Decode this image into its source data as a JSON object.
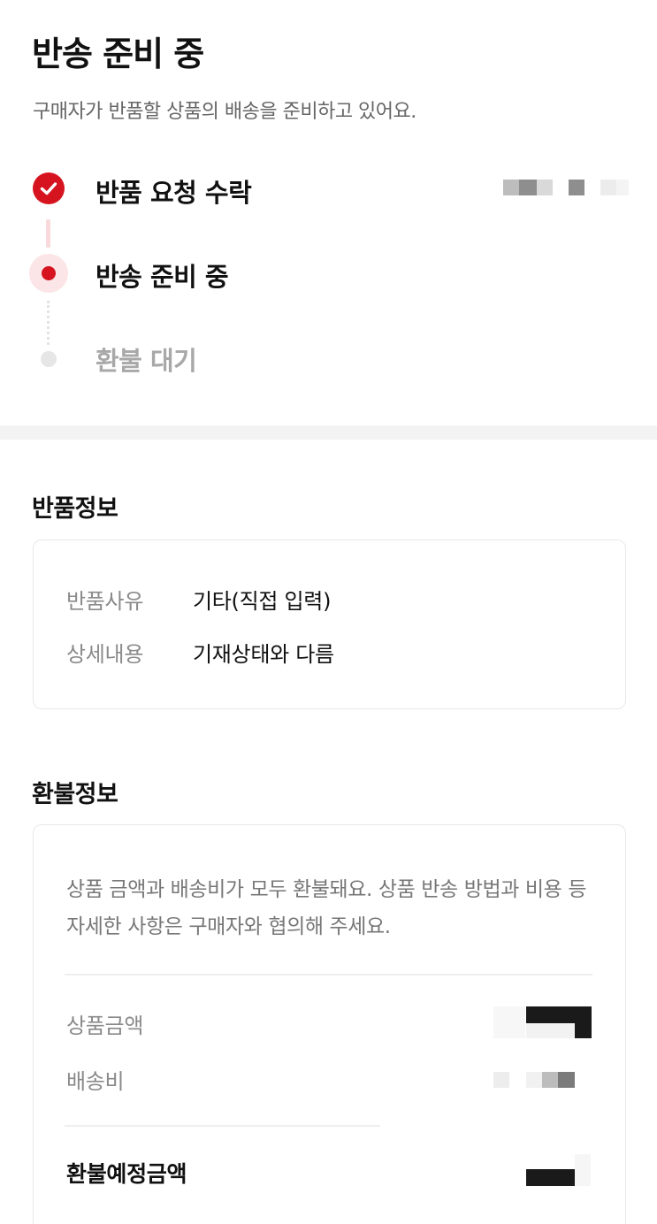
{
  "header": {
    "title": "반송 준비 중",
    "subtitle": "구매자가 반품할 상품의 배송을 준비하고 있어요."
  },
  "steps": [
    {
      "label": "반품 요청 수락",
      "state": "done",
      "date": ""
    },
    {
      "label": "반송 준비 중",
      "state": "current"
    },
    {
      "label": "환불 대기",
      "state": "pending"
    }
  ],
  "return_info": {
    "title": "반품정보",
    "rows": [
      {
        "label": "반품사유",
        "value": "기타(직접 입력)"
      },
      {
        "label": "상세내용",
        "value": "기재상태와 다름"
      }
    ]
  },
  "refund_info": {
    "title": "환불정보",
    "notice": "상품 금액과 배송비가 모두 환불돼요. 상품 반송 방법과 비용 등 자세한 사항은 구매자와 협의해 주세요.",
    "rows": [
      {
        "label": "상품금액",
        "value": ""
      },
      {
        "label": "배송비",
        "value": ""
      }
    ],
    "total_label": "환불예정금액",
    "total_value": ""
  },
  "colors": {
    "accent": "#d6141f",
    "accent_light": "#fbe5e6",
    "pending": "#e6e6e6",
    "muted_text": "#8a8a8a",
    "band": "#f3f3f3"
  }
}
